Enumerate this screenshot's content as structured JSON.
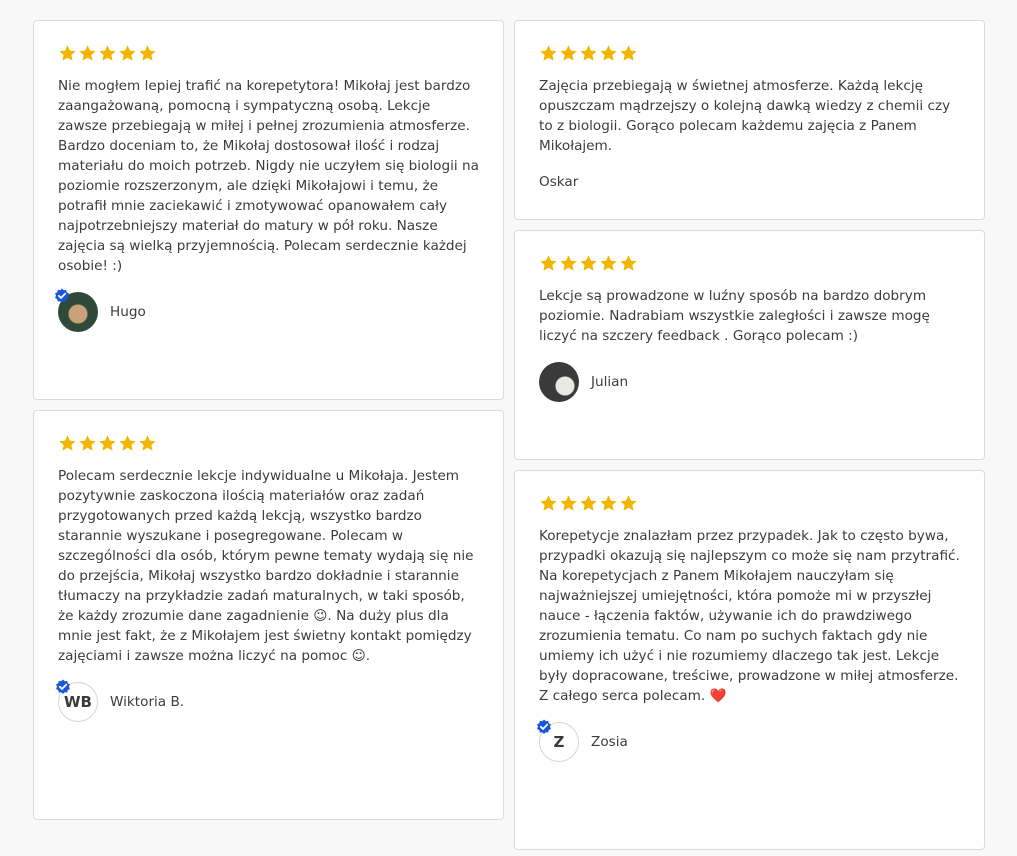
{
  "colors": {
    "star": "#f2b600",
    "verified": "#1a56db",
    "card_border": "#dcdcdc",
    "page_background": "#f8f8f8"
  },
  "rating_max": 5,
  "reviews": [
    {
      "rating": 5,
      "text": "Nie mogłem lepiej trafić na korepetytora! Mikołaj jest bardzo zaangażowaną, pomocną i sympatyczną osobą. Lekcje zawsze przebiegają w miłej i pełnej zrozumienia atmosferze. Bardzo doceniam to, że Mikołaj dostosował ilość i rodzaj materiału do moich potrzeb. Nigdy nie uczyłem się biologii na poziomie rozszerzonym, ale dzięki Mikołajowi i temu, że potrafił mnie zaciekawić i zmotywować opanowałem cały najpotrzebniejszy materiał do matury w pół roku. Nasze zajęcia są wielką przyjemnością. Polecam serdecznie każdej osobie! :)",
      "author": "Hugo",
      "verified": true
    },
    {
      "rating": 5,
      "text": "Polecam serdecznie lekcje indywidualne u Mikołaja. Jestem pozytywnie zaskoczona ilością materiałów oraz zadań przygotowanych przed każdą lekcją, wszystko bardzo starannie wyszukane i posegregowane. Polecam w szczególności dla osób, którym pewne tematy wydają się nie do przejścia, Mikołaj wszystko bardzo dokładnie i starannie tłumaczy na przykładzie zadań maturalnych, w taki sposób, że każdy zrozumie dane zagadnienie 😉. Na duży plus dla mnie jest fakt, że z Mikołajem jest świetny kontakt pomiędzy zajęciami i zawsze można liczyć na pomoc ☺.",
      "author": "Wiktoria B.",
      "initials": "WB",
      "verified": true
    },
    {
      "rating": 5,
      "text": "Zajęcia przebiegają w świetnej atmosferze. Każdą lekcję opuszczam mądrzejszy o kolejną dawką wiedzy z chemii czy to z biologii. Gorąco polecam każdemu zajęcia z Panem Mikołajem.",
      "author": "Oskar",
      "verified": false
    },
    {
      "rating": 5,
      "text": "Lekcje są prowadzone w luźny sposób na bardzo dobrym poziomie. Nadrabiam wszystkie zaległości i zawsze mogę liczyć na szczery feedback . Gorąco polecam :)",
      "author": "Julian",
      "verified": false
    },
    {
      "rating": 5,
      "text": "Korepetycje znalazłam przez przypadek. Jak to często bywa, przypadki okazują się najlepszym co może się nam przytrafić. Na korepetycjach z Panem Mikołajem nauczyłam się najważniejszej umiejętności, która pomoże mi w przyszłej nauce - łączenia faktów, używanie ich do prawdziwego zrozumienia tematu. Co nam po suchych faktach gdy nie umiemy ich użyć i nie rozumiemy dlaczego tak jest. Lekcje były dopracowane, treściwe, prowadzone w miłej atmosferze. Z całego serca polecam. ❤️",
      "author": "Zosia",
      "initials": "Z",
      "verified": true
    }
  ]
}
